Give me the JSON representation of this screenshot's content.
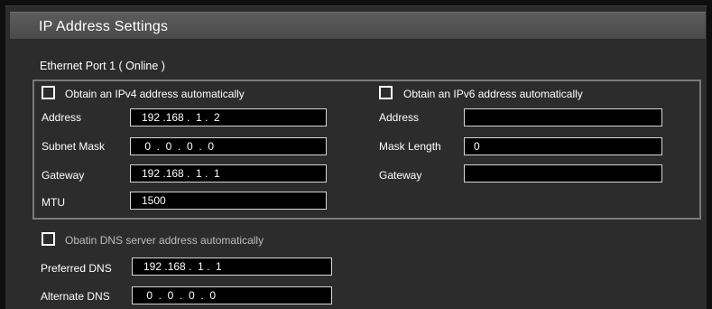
{
  "window": {
    "title": "IP Address Settings"
  },
  "section": {
    "title": "Ethernet Port 1 ( Online )"
  },
  "ipv4": {
    "auto_label": "Obtain an IPv4 address automatically",
    "auto_checked": false,
    "address_label": "Address",
    "address_value": "192 .168 .  1 .  2",
    "subnet_label": "Subnet Mask",
    "subnet_value": " 0  .  0  .  0  .  0",
    "gateway_label": "Gateway",
    "gateway_value": "192 .168 .  1 .  1",
    "mtu_label": "MTU",
    "mtu_value": "1500"
  },
  "ipv6": {
    "auto_label": "Obtain an IPv6 address automatically",
    "auto_checked": false,
    "address_label": "Address",
    "address_value": "",
    "mask_label": "Mask Length",
    "mask_value": "0",
    "gateway_label": "Gateway",
    "gateway_value": ""
  },
  "dns": {
    "auto_label": "Obatin DNS server address automatically",
    "auto_checked": false,
    "preferred_label": "Preferred DNS",
    "preferred_value": "192 .168 .  1 .  1",
    "alternate_label": "Alternate DNS",
    "alternate_value": " 0  .  0  .  0  .  0"
  }
}
